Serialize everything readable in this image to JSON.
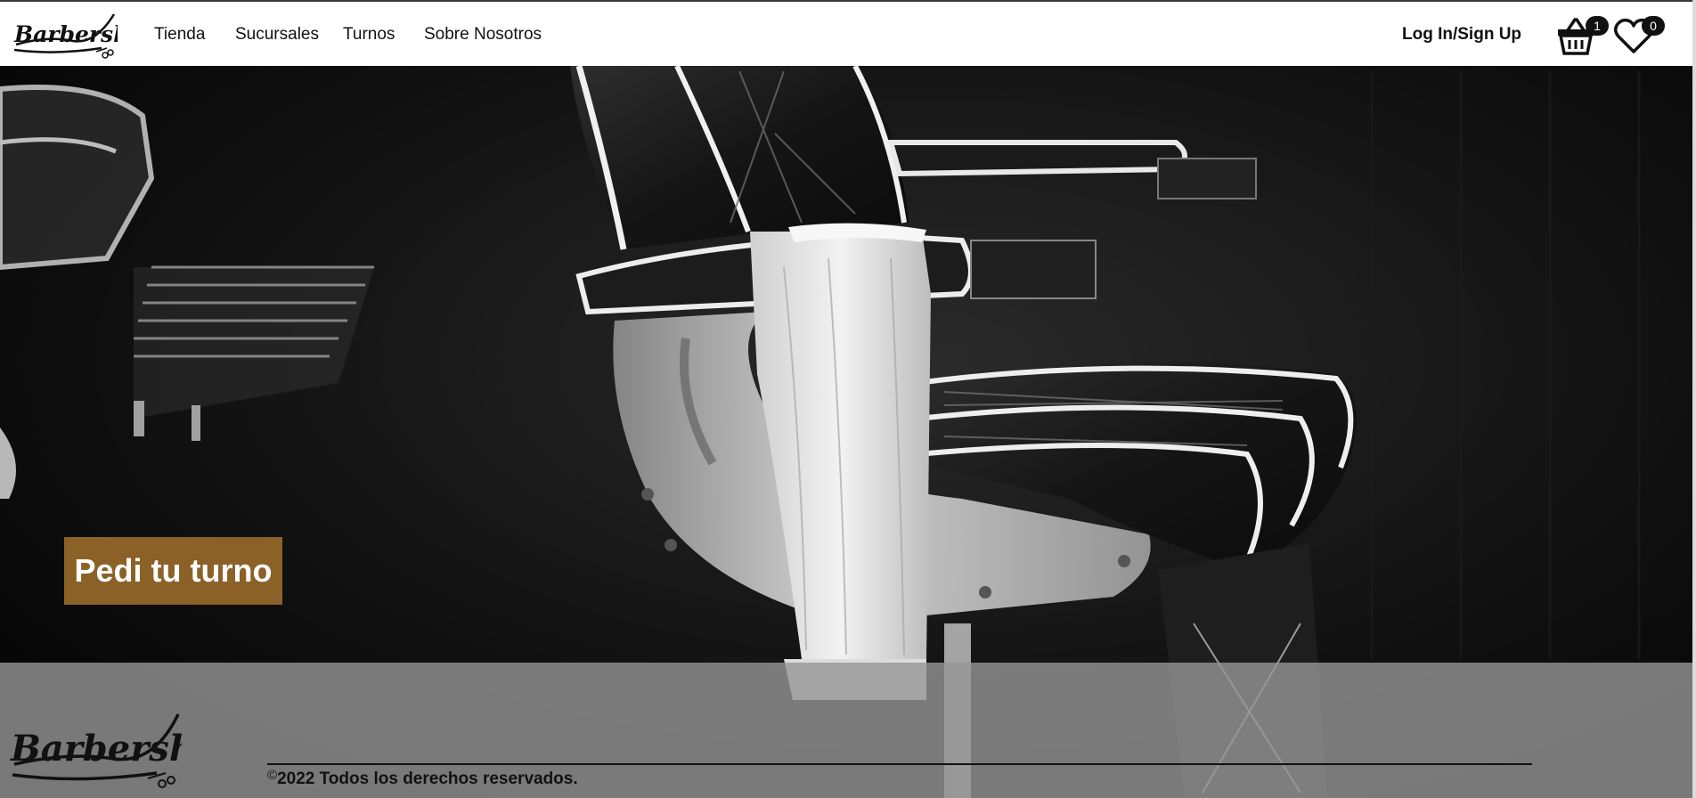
{
  "brand": {
    "logo_text": "Barbershop"
  },
  "nav": {
    "links": [
      {
        "label": "Tienda"
      },
      {
        "label": "Sucursales"
      },
      {
        "label": "Turnos"
      },
      {
        "label": "Sobre Nosotros"
      }
    ],
    "login_label": "Log In/Sign Up",
    "cart": {
      "icon": "basket-icon",
      "count": "1"
    },
    "favorites": {
      "icon": "heart-icon",
      "count": "0"
    }
  },
  "hero": {
    "image": "barber-chair-photo",
    "cta_label": "Pedi tu turno"
  },
  "footer": {
    "logo_text": "Barbershop",
    "copyright_symbol": "©",
    "copyright_text": "2022 Todos los derechos reservados."
  },
  "colors": {
    "cta_background": "#8b6128",
    "navbar_background": "#ffffff",
    "footer_background": "#969696",
    "text": "#111111"
  }
}
